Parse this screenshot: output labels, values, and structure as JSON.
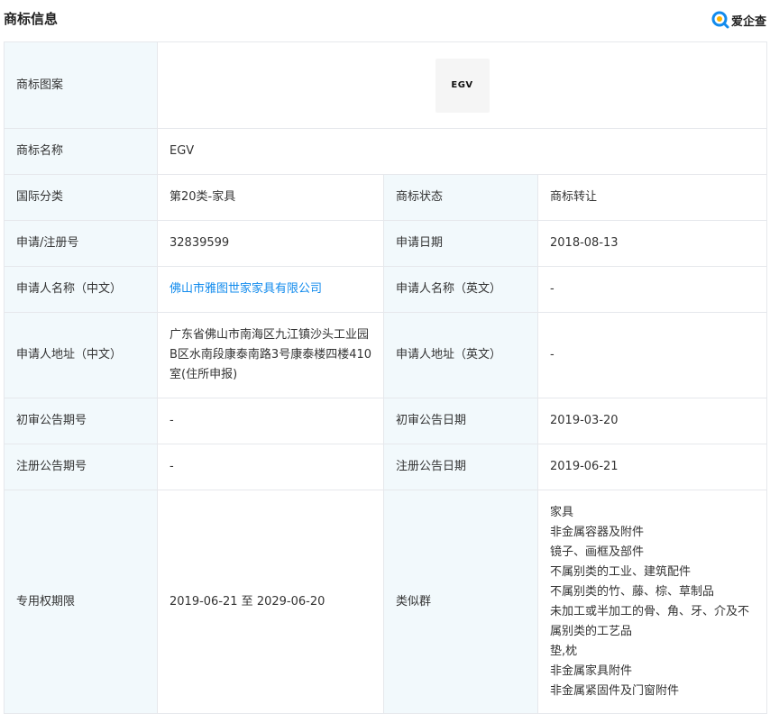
{
  "header": {
    "title": "商标信息",
    "brand": "爱企查"
  },
  "rows": {
    "pattern": {
      "label": "商标图案",
      "logo_text": "EGV"
    },
    "name": {
      "label": "商标名称",
      "value": "EGV"
    },
    "class": {
      "label": "国际分类",
      "value": "第20类-家具",
      "label2": "商标状态",
      "value2": "商标转让"
    },
    "reg": {
      "label": "申请/注册号",
      "value": "32839599",
      "label2": "申请日期",
      "value2": "2018-08-13"
    },
    "applicant": {
      "label": "申请人名称（中文）",
      "value": "佛山市雅图世家家具有限公司",
      "label2": "申请人名称（英文）",
      "value2": "-"
    },
    "address": {
      "label": "申请人地址（中文）",
      "value": "广东省佛山市南海区九江镇沙头工业园B区水南段康泰南路3号康泰楼四楼410室(住所申报)",
      "label2": "申请人地址（英文）",
      "value2": "-"
    },
    "prelim": {
      "label": "初审公告期号",
      "value": "-",
      "label2": "初审公告日期",
      "value2": "2019-03-20"
    },
    "regpub": {
      "label": "注册公告期号",
      "value": "-",
      "label2": "注册公告日期",
      "value2": "2019-06-21"
    },
    "term": {
      "label": "专用权期限",
      "value": "2019-06-21 至 2029-06-20",
      "label2": "类似群",
      "similar": [
        "家具",
        "非金属容器及附件",
        "镜子、画框及部件",
        "不属别类的工业、建筑配件",
        "不属别类的竹、藤、棕、草制品",
        "未加工或半加工的骨、角、牙、介及不属别类的工艺品",
        "垫,枕",
        "非金属家具附件",
        "非金属紧固件及门窗附件"
      ]
    }
  },
  "colors": {
    "label_bg": "#f2f9fc",
    "border": "#e6e8ec",
    "link": "#128bed",
    "brand": "#128bed"
  }
}
